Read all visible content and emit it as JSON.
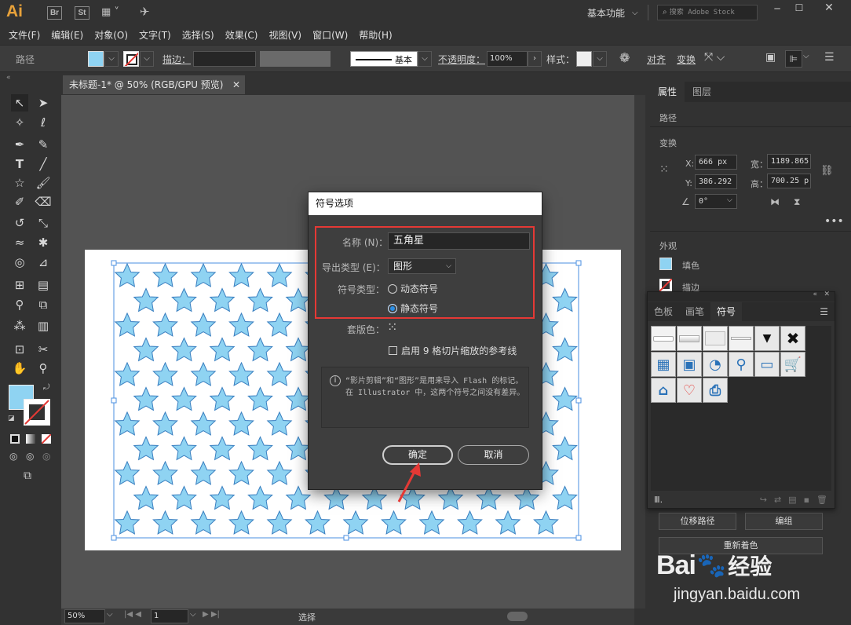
{
  "app": {
    "logo": "Ai",
    "bridge": "Br",
    "stock": "St",
    "workspace": "基本功能",
    "search_placeholder": "搜索 Adobe Stock"
  },
  "menu": [
    "文件(F)",
    "编辑(E)",
    "对象(O)",
    "文字(T)",
    "选择(S)",
    "效果(C)",
    "视图(V)",
    "窗口(W)",
    "帮助(H)"
  ],
  "control_bar": {
    "selection_type": "路径",
    "stroke_label": "描边：",
    "brush_label": "基本",
    "opacity_label": "不透明度：",
    "opacity_value": "100%",
    "style_label": "样式：",
    "align_label": "对齐",
    "transform_label": "变换"
  },
  "document": {
    "tab_title": "未标题-1* @ 50% (RGB/GPU 预览)",
    "zoom": "50%",
    "page": "1",
    "status_tool": "选择"
  },
  "properties_panel": {
    "tab_properties": "属性",
    "tab_layers": "图层",
    "object_type": "路径",
    "transform_title": "变换",
    "x_label": "X:",
    "x_value": "666 px",
    "y_label": "Y:",
    "y_value": "386.292",
    "w_label": "宽：",
    "w_value": "1189.865",
    "h_label": "高：",
    "h_value": "700.25 p",
    "angle_value": "0°",
    "appearance_title": "外观",
    "fill_label": "填色",
    "stroke_label": "描边",
    "offset_path_button": "位移路径",
    "group_button": "编组",
    "recolor_button": "重新着色"
  },
  "symbols_panel": {
    "tabs": [
      "色板",
      "画笔",
      "符号"
    ],
    "active_tab": "符号"
  },
  "dialog": {
    "title": "符号选项",
    "name_label": "名称 (N)：",
    "name_value": "五角星",
    "export_label": "导出类型 (E)：",
    "export_value": "图形",
    "symbol_type_label": "符号类型：",
    "dynamic_label": "动态符号",
    "static_label": "静态符号",
    "registration_label": "套版色：",
    "nine_slice_label": "启用 9 格切片缩放的参考线",
    "info_text": "“影片剪辑”和“图形”是用来导入 Flash 的标记。在 Illustrator 中，这两个符号之间没有差异。",
    "ok_button": "确定",
    "cancel_button": "取消"
  },
  "watermark": {
    "brand": "Bai",
    "brand_suffix": "经验",
    "url": "jingyan.baidu.com"
  },
  "colors": {
    "accent_logo": "#e8a23a",
    "star_fill": "#8fd3f2",
    "star_stroke": "#3a7fc0",
    "highlight_box": "#e53935",
    "arrow": "#e53935"
  }
}
